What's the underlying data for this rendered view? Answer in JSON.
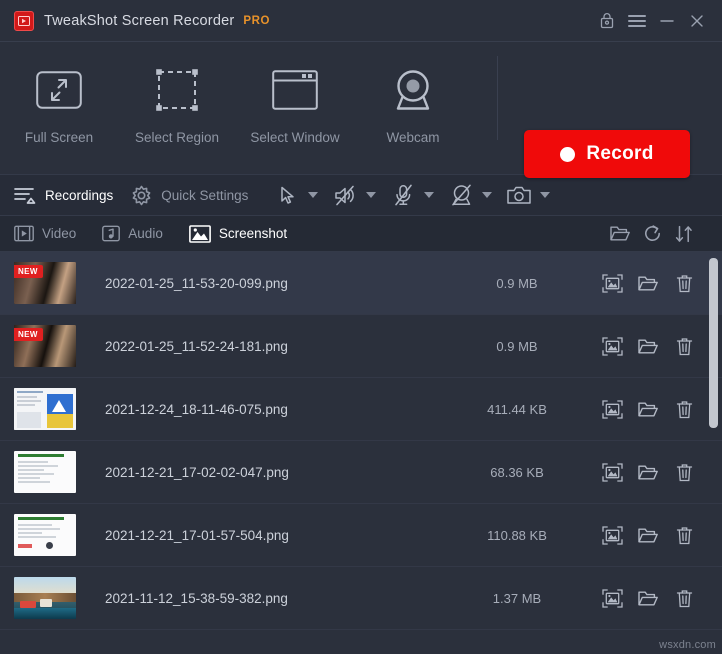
{
  "titlebar": {
    "app_name": "TweakShot Screen Recorder",
    "pro_label": "PRO",
    "logo_icon": "tweakshot-logo-icon",
    "buttons": [
      {
        "name": "lock-icon",
        "tooltip": "Lock"
      },
      {
        "name": "hamburger-menu-icon",
        "tooltip": "Menu"
      },
      {
        "name": "minimize-icon",
        "tooltip": "Minimize"
      },
      {
        "name": "close-icon",
        "tooltip": "Close"
      }
    ]
  },
  "modes": [
    {
      "label": "Full Screen",
      "icon": "full-screen-icon"
    },
    {
      "label": "Select Region",
      "icon": "select-region-icon"
    },
    {
      "label": "Select Window",
      "icon": "select-window-icon"
    },
    {
      "label": "Webcam",
      "icon": "webcam-icon"
    }
  ],
  "record": {
    "label": "Record",
    "color": "#f00a0a",
    "dot_icon": "record-dot-icon"
  },
  "secondary_bar": {
    "recordings_label": "Recordings",
    "recordings_icon": "recordings-icon",
    "quick_settings_label": "Quick Settings",
    "quick_settings_icon": "gear-icon",
    "tools": [
      {
        "icon": "cursor-icon",
        "caret": "chevron-down-icon"
      },
      {
        "icon": "speaker-muted-icon",
        "caret": "chevron-down-icon"
      },
      {
        "icon": "microphone-muted-icon",
        "caret": "chevron-down-icon"
      },
      {
        "icon": "webcam-off-icon",
        "caret": "chevron-down-icon"
      },
      {
        "icon": "camera-icon",
        "caret": "chevron-down-icon"
      }
    ]
  },
  "tabs": [
    {
      "label": "Video",
      "icon": "video-icon",
      "active": false
    },
    {
      "label": "Audio",
      "icon": "audio-note-icon",
      "active": false
    },
    {
      "label": "Screenshot",
      "icon": "image-icon",
      "active": true
    }
  ],
  "tab_tools": [
    {
      "name": "open-folder-icon"
    },
    {
      "name": "refresh-icon"
    },
    {
      "name": "sort-icon"
    }
  ],
  "list": {
    "row_actions": [
      {
        "name": "preview-image-icon"
      },
      {
        "name": "open-folder-icon"
      },
      {
        "name": "delete-icon"
      }
    ],
    "new_badge_label": "NEW",
    "rows": [
      {
        "filename": "2022-01-25_11-53-20-099.png",
        "size": "0.9 MB",
        "new": true,
        "selected": true,
        "thumb": "photo-indoor"
      },
      {
        "filename": "2022-01-25_11-52-24-181.png",
        "size": "0.9 MB",
        "new": true,
        "selected": false,
        "thumb": "photo-indoor"
      },
      {
        "filename": "2021-12-24_18-11-46-075.png",
        "size": "411.44 KB",
        "new": false,
        "selected": false,
        "thumb": "doc-colorful"
      },
      {
        "filename": "2021-12-21_17-02-02-047.png",
        "size": "68.36 KB",
        "new": false,
        "selected": false,
        "thumb": "doc-green"
      },
      {
        "filename": "2021-12-21_17-01-57-504.png",
        "size": "110.88 KB",
        "new": false,
        "selected": false,
        "thumb": "doc-green"
      },
      {
        "filename": "2021-11-12_15-38-59-382.png",
        "size": "1.37 MB",
        "new": false,
        "selected": false,
        "thumb": "photo-landscape"
      }
    ]
  },
  "scrollbar": {
    "name": "vertical-scrollbar"
  },
  "watermark": "wsxdn.com"
}
